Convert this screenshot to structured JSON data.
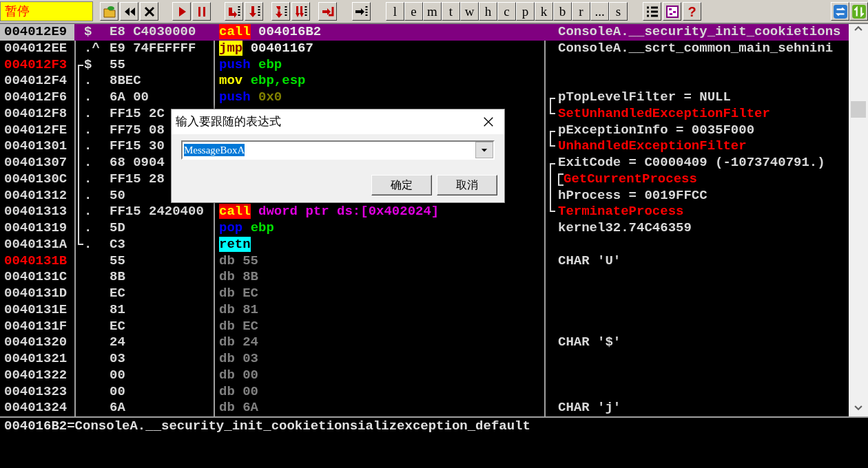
{
  "toolbar": {
    "status": "暂停",
    "letter_buttons": [
      "l",
      "e",
      "m",
      "t",
      "w",
      "h",
      "c",
      "p",
      "k",
      "b",
      "r",
      "...",
      "s"
    ],
    "help_button": "?"
  },
  "disassembly": {
    "rows": [
      {
        "address": {
          "text": "004012E9",
          "kind": "normal"
        },
        "selected": true,
        "marker": "$",
        "hex": "E8 C4030000",
        "instruction": {
          "mnemonic": "call",
          "operand": {
            "text": "004016B2",
            "kind": "address"
          }
        },
        "comment": {
          "text": "ConsoleA.__security_init_cookietions",
          "kind": "text"
        }
      },
      {
        "address": {
          "text": "004012EE",
          "kind": "normal"
        },
        "selected": false,
        "marker": ".^",
        "hex": "E9 74FEFFFF",
        "instruction": {
          "mnemonic": "jmp",
          "operand": {
            "text": "00401167",
            "kind": "address"
          }
        },
        "comment": {
          "text": "ConsoleA.__scrt_common_main_sehnini",
          "kind": "text"
        }
      },
      {
        "address": {
          "text": "004012F3",
          "kind": "target"
        },
        "selected": false,
        "bracket": {
          "kind": "open"
        },
        "marker": "$",
        "hex": "55",
        "instruction": {
          "mnemonic": "push",
          "operand": {
            "text": "ebp",
            "kind": "register"
          }
        }
      },
      {
        "address": {
          "text": "004012F4",
          "kind": "normal"
        },
        "selected": false,
        "bracket": {
          "kind": "line"
        },
        "marker": ".",
        "hex": "8BEC",
        "instruction": {
          "mnemonic": "mov",
          "operand": {
            "text": "ebp,esp",
            "kind": "register"
          }
        }
      },
      {
        "address": {
          "text": "004012F6",
          "kind": "normal"
        },
        "selected": false,
        "bracket": {
          "kind": "line"
        },
        "marker": ".",
        "hex": "6A 00",
        "instruction": {
          "mnemonic": "push",
          "operand": {
            "text": "0x0",
            "kind": "constant"
          }
        },
        "comment": {
          "text": "pTopLevelFilter = NULL",
          "kind": "text",
          "bracket": {
            "kind": "open"
          }
        }
      },
      {
        "address": {
          "text": "004012F8",
          "kind": "normal"
        },
        "selected": false,
        "bracket": {
          "kind": "line"
        },
        "marker": ".",
        "hex": "FF15 2C",
        "comment": {
          "text": "SetUnhandledExceptionFilter",
          "kind": "api",
          "bracket": {
            "kind": "close"
          }
        }
      },
      {
        "address": {
          "text": "004012FE",
          "kind": "normal"
        },
        "selected": false,
        "bracket": {
          "kind": "line"
        },
        "marker": ".",
        "hex": "FF75 08",
        "comment": {
          "text": "pExceptionInfo = 0035F000",
          "kind": "text",
          "bracket": {
            "kind": "open"
          }
        }
      },
      {
        "address": {
          "text": "00401301",
          "kind": "normal"
        },
        "selected": false,
        "bracket": {
          "kind": "line"
        },
        "marker": ".",
        "hex": "FF15 30",
        "comment": {
          "text": "UnhandledExceptionFilter",
          "kind": "api",
          "bracket": {
            "kind": "close"
          }
        }
      },
      {
        "address": {
          "text": "00401307",
          "kind": "normal"
        },
        "selected": false,
        "bracket": {
          "kind": "line"
        },
        "marker": ".",
        "hex": "68 0904",
        "comment": {
          "text": "ExitCode = C0000409 (-1073740791.)",
          "kind": "text",
          "bracket": {
            "kind": "open"
          }
        }
      },
      {
        "address": {
          "text": "0040130C",
          "kind": "normal"
        },
        "selected": false,
        "bracket": {
          "kind": "line"
        },
        "marker": ".",
        "hex": "FF15 28",
        "comment": {
          "text": "GetCurrentProcess",
          "kind": "api",
          "bracket": {
            "kind": "nested"
          }
        }
      },
      {
        "address": {
          "text": "00401312",
          "kind": "normal"
        },
        "selected": false,
        "bracket": {
          "kind": "line"
        },
        "marker": ".",
        "hex": "50",
        "comment": {
          "text": "hProcess = 0019FFCC",
          "kind": "text",
          "bracket": {
            "kind": "line"
          }
        }
      },
      {
        "address": {
          "text": "00401313",
          "kind": "normal"
        },
        "selected": false,
        "bracket": {
          "kind": "line"
        },
        "marker": ".",
        "hex": "FF15 2420400",
        "instruction": {
          "mnemonic": "call",
          "operand": {
            "text": "dword ptr ds:[0x402024]",
            "kind": "memory"
          }
        },
        "comment": {
          "text": "TerminateProcess",
          "kind": "api",
          "bracket": {
            "kind": "close"
          }
        }
      },
      {
        "address": {
          "text": "00401319",
          "kind": "normal"
        },
        "selected": false,
        "bracket": {
          "kind": "line"
        },
        "marker": ".",
        "hex": "5D",
        "instruction": {
          "mnemonic": "pop",
          "operand": {
            "text": "ebp",
            "kind": "register"
          }
        },
        "comment": {
          "text": "kernel32.74C46359",
          "kind": "text"
        }
      },
      {
        "address": {
          "text": "0040131A",
          "kind": "normal"
        },
        "selected": false,
        "bracket": {
          "kind": "close"
        },
        "marker": ".",
        "hex": "C3",
        "instruction": {
          "mnemonic": "retn"
        }
      },
      {
        "address": {
          "text": "0040131B",
          "kind": "target"
        },
        "selected": false,
        "hex": "55",
        "instruction": {
          "mnemonic": "db",
          "operand": {
            "text": "55",
            "kind": "data"
          }
        },
        "comment": {
          "text": "CHAR 'U'",
          "kind": "text"
        }
      },
      {
        "address": {
          "text": "0040131C",
          "kind": "normal"
        },
        "selected": false,
        "hex": "8B",
        "instruction": {
          "mnemonic": "db",
          "operand": {
            "text": "8B",
            "kind": "data"
          }
        }
      },
      {
        "address": {
          "text": "0040131D",
          "kind": "normal"
        },
        "selected": false,
        "hex": "EC",
        "instruction": {
          "mnemonic": "db",
          "operand": {
            "text": "EC",
            "kind": "data"
          }
        }
      },
      {
        "address": {
          "text": "0040131E",
          "kind": "normal"
        },
        "selected": false,
        "hex": "81",
        "instruction": {
          "mnemonic": "db",
          "operand": {
            "text": "81",
            "kind": "data"
          }
        }
      },
      {
        "address": {
          "text": "0040131F",
          "kind": "normal"
        },
        "selected": false,
        "hex": "EC",
        "instruction": {
          "mnemonic": "db",
          "operand": {
            "text": "EC",
            "kind": "data"
          }
        }
      },
      {
        "address": {
          "text": "00401320",
          "kind": "normal"
        },
        "selected": false,
        "hex": "24",
        "instruction": {
          "mnemonic": "db",
          "operand": {
            "text": "24",
            "kind": "data"
          }
        },
        "comment": {
          "text": "CHAR '$'",
          "kind": "text"
        }
      },
      {
        "address": {
          "text": "00401321",
          "kind": "normal"
        },
        "selected": false,
        "hex": "03",
        "instruction": {
          "mnemonic": "db",
          "operand": {
            "text": "03",
            "kind": "data"
          }
        }
      },
      {
        "address": {
          "text": "00401322",
          "kind": "normal"
        },
        "selected": false,
        "hex": "00",
        "instruction": {
          "mnemonic": "db",
          "operand": {
            "text": "00",
            "kind": "data"
          }
        }
      },
      {
        "address": {
          "text": "00401323",
          "kind": "normal"
        },
        "selected": false,
        "hex": "00",
        "instruction": {
          "mnemonic": "db",
          "operand": {
            "text": "00",
            "kind": "data"
          }
        }
      },
      {
        "address": {
          "text": "00401324",
          "kind": "normal"
        },
        "selected": false,
        "hex": "6A",
        "instruction": {
          "mnemonic": "db",
          "operand": {
            "text": "6A",
            "kind": "data"
          }
        },
        "comment": {
          "text": "CHAR 'j'",
          "kind": "text"
        }
      }
    ]
  },
  "info_line": "004016B2=ConsoleA.__security_init_cookietionsializexception_default",
  "dialog": {
    "title": "输入要跟随的表达式",
    "value": "MessageBoxA",
    "value_selected": true,
    "buttons": [
      "确定",
      "取消"
    ]
  }
}
